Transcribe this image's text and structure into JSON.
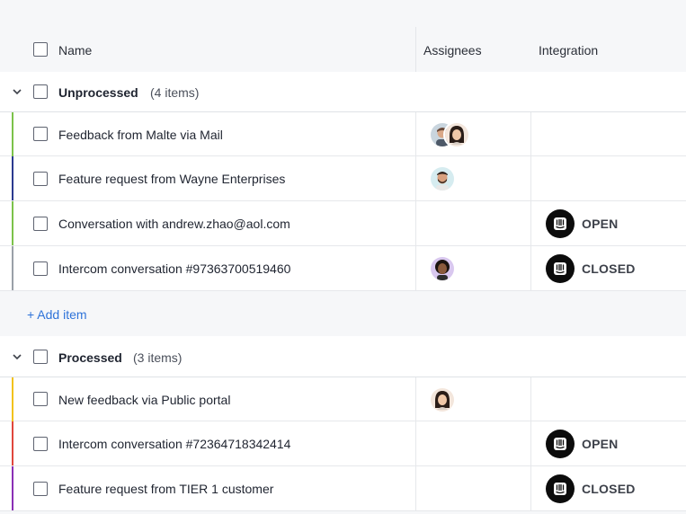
{
  "columns": {
    "name": "Name",
    "assignees": "Assignees",
    "integration": "Integration"
  },
  "groups": [
    {
      "name": "Unprocessed",
      "count": "(4 items)",
      "rows": [
        {
          "name": "Feedback from Malte via Mail",
          "bar_color": "#7cc24a",
          "assignees": [
            "man-avatar",
            "woman-avatar"
          ],
          "status": ""
        },
        {
          "name": "Feature request from Wayne Enterprises",
          "bar_color": "#2b3a8f",
          "assignees": [
            "man-beard-avatar"
          ],
          "status": ""
        },
        {
          "name": "Conversation with andrew.zhao@aol.com",
          "bar_color": "#7cc24a",
          "assignees": [],
          "status": "OPEN"
        },
        {
          "name": "Intercom conversation #97363700519460",
          "bar_color": "#9aa0a8",
          "assignees": [
            "woman-curly-avatar"
          ],
          "status": "CLOSED"
        }
      ],
      "add_label": "+ Add item"
    },
    {
      "name": "Processed",
      "count": "(3 items)",
      "rows": [
        {
          "name": "New feedback via Public portal",
          "bar_color": "#f2c21b",
          "assignees": [
            "woman-avatar"
          ],
          "status": ""
        },
        {
          "name": "Intercom conversation #72364718342414",
          "bar_color": "#e0463c",
          "assignees": [],
          "status": "OPEN"
        },
        {
          "name": "Feature request from TIER 1 customer",
          "bar_color": "#8a2fb5",
          "assignees": [],
          "status": "CLOSED"
        }
      ]
    }
  ],
  "integration_icon": "intercom-icon"
}
